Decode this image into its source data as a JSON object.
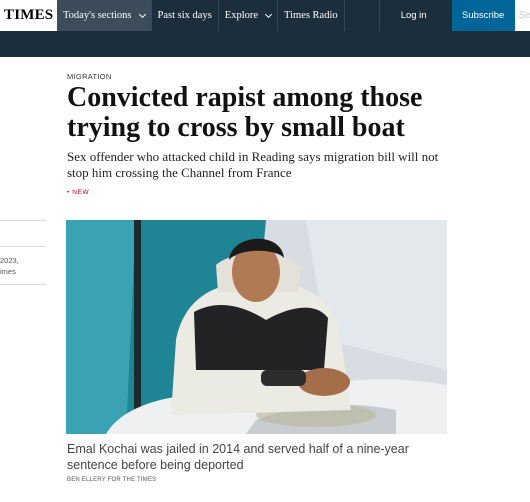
{
  "nav": {
    "logo": "TIMES",
    "items": [
      {
        "label": "Today's sections",
        "dropdown": true,
        "active": true
      },
      {
        "label": "Past six days",
        "dropdown": false,
        "active": false
      },
      {
        "label": "Explore",
        "dropdown": true,
        "active": false
      },
      {
        "label": "Times Radio",
        "dropdown": false,
        "active": false
      }
    ],
    "login_label": "Log in",
    "subscribe_label": "Subscribe",
    "search_placeholder": "Search"
  },
  "rail": {
    "date_fragment": "2023,",
    "source_fragment": "imes"
  },
  "article": {
    "kicker": "MIGRATION",
    "headline": "Convicted rapist among those trying to cross by small boat",
    "standfirst": "Sex offender who attacked child in Reading says migration bill will not stop him crossing the Channel from France",
    "flag": "• NEW",
    "image_alt": "Man sitting in a tent wrapped in a blanket",
    "caption": "Emal Kochai was jailed in 2014 and served half of a nine-year sentence before being deported",
    "credit": "BEN ELLERY FOR THE TIMES"
  },
  "colors": {
    "nav_bg": "#1c2d3c",
    "subscribe_bg": "#006699",
    "flag_red": "#d0021b"
  },
  "icons": {
    "dropdown": "chevron-down-icon"
  }
}
